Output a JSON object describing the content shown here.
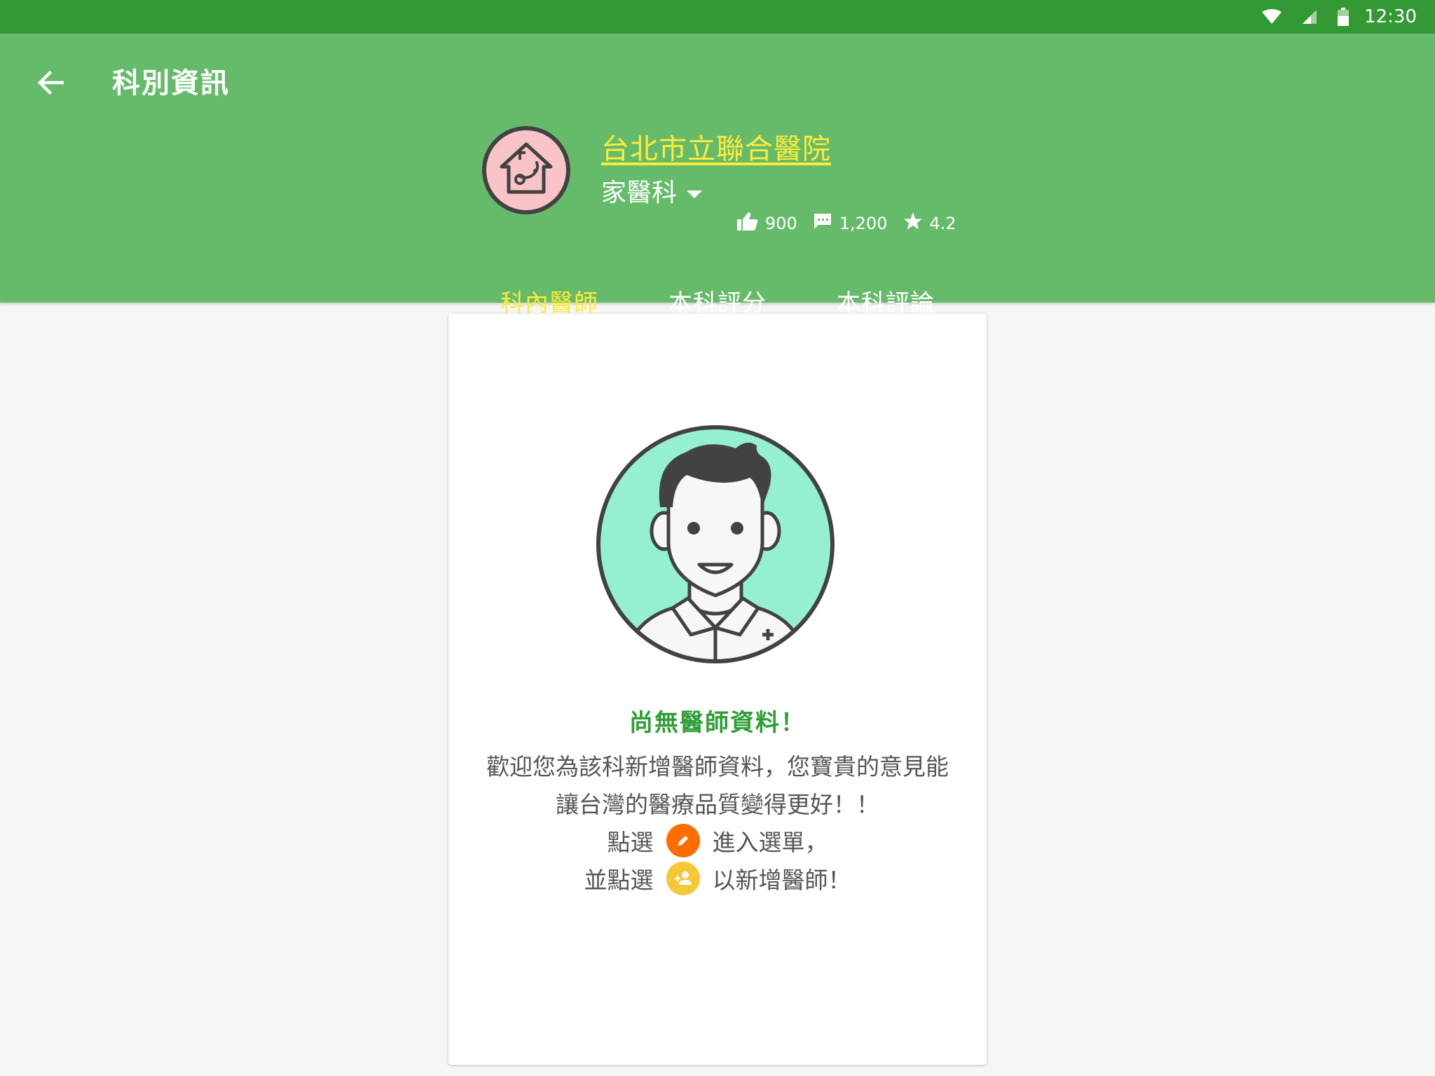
{
  "status_bar": {
    "time": "12:30",
    "icons": [
      "wifi-icon",
      "cell-signal-icon",
      "battery-icon"
    ]
  },
  "app_bar": {
    "title": "科別資訊",
    "back_icon": "arrow-back-icon"
  },
  "hospital": {
    "name": "台北市立聯合醫院",
    "avatar_icon": "house-stethoscope-icon",
    "department": "家醫科",
    "likes": "900",
    "comments": "1,200",
    "rating": "4.2"
  },
  "tabs": [
    {
      "label": "科內醫師",
      "active": true
    },
    {
      "label": "本科評分",
      "active": false
    },
    {
      "label": "本科評論",
      "active": false
    }
  ],
  "empty_state": {
    "avatar_icon": "doctor-avatar-icon",
    "title": "尚無醫師資料！",
    "message": "歡迎您為該科新增醫師資料，您寶貴的意見能讓台灣的醫療品質變得更好！！",
    "line1_prefix": "點選",
    "line1_suffix": "進入選單，",
    "line2_prefix": "並點選",
    "line2_suffix": "以新增醫師！",
    "edit_icon": "pencil-icon",
    "add_icon": "add-person-icon"
  },
  "colors": {
    "status_bar": "#339935",
    "header": "#66bb6a",
    "accent": "#ffeb3b",
    "title_green": "#2e9e36",
    "orange": "#ff6d00",
    "yellow": "#f6c736"
  }
}
